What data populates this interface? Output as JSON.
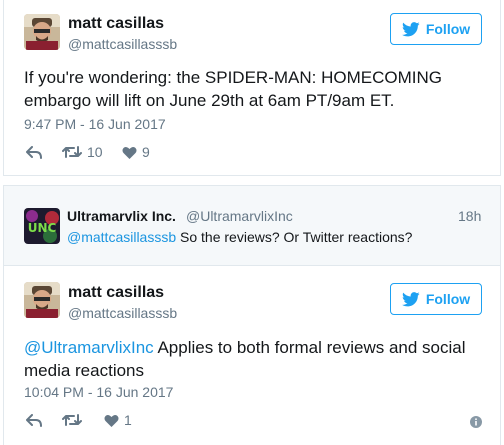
{
  "tweet1": {
    "name": "matt casillas",
    "handle": "@mattcasillasssb",
    "follow_label": "Follow",
    "text": "If you're wondering: the SPIDER-MAN: HOMECOMING embargo will lift on June 29th at 6am PT/9am ET.",
    "timestamp": "9:47 PM - 16 Jun 2017",
    "retweets": "10",
    "likes": "9"
  },
  "context_reply": {
    "name": "Ultramarvlix Inc.",
    "handle": "@UltramarvlixInc",
    "time": "18h",
    "mention": "@mattcasillasssb",
    "text": " So the reviews? Or Twitter reactions?",
    "avatar_text": "UNC"
  },
  "tweet2": {
    "name": "matt casillas",
    "handle": "@mattcasillasssb",
    "follow_label": "Follow",
    "mention": "@UltramarvlixInc",
    "text_line1": " Applies to both formal reviews and social",
    "text_line2": "media reactions",
    "timestamp": "10:04 PM - 16 Jun 2017",
    "likes": "1"
  },
  "icons": [
    "twitter-bird-icon",
    "reply-icon",
    "retweet-icon",
    "heart-icon",
    "info-icon"
  ],
  "colors": {
    "accent": "#1da1f2",
    "link": "#1b95e0",
    "muted": "#657786",
    "border": "#e1e8ed",
    "reply_bg": "#f5f8fa"
  }
}
